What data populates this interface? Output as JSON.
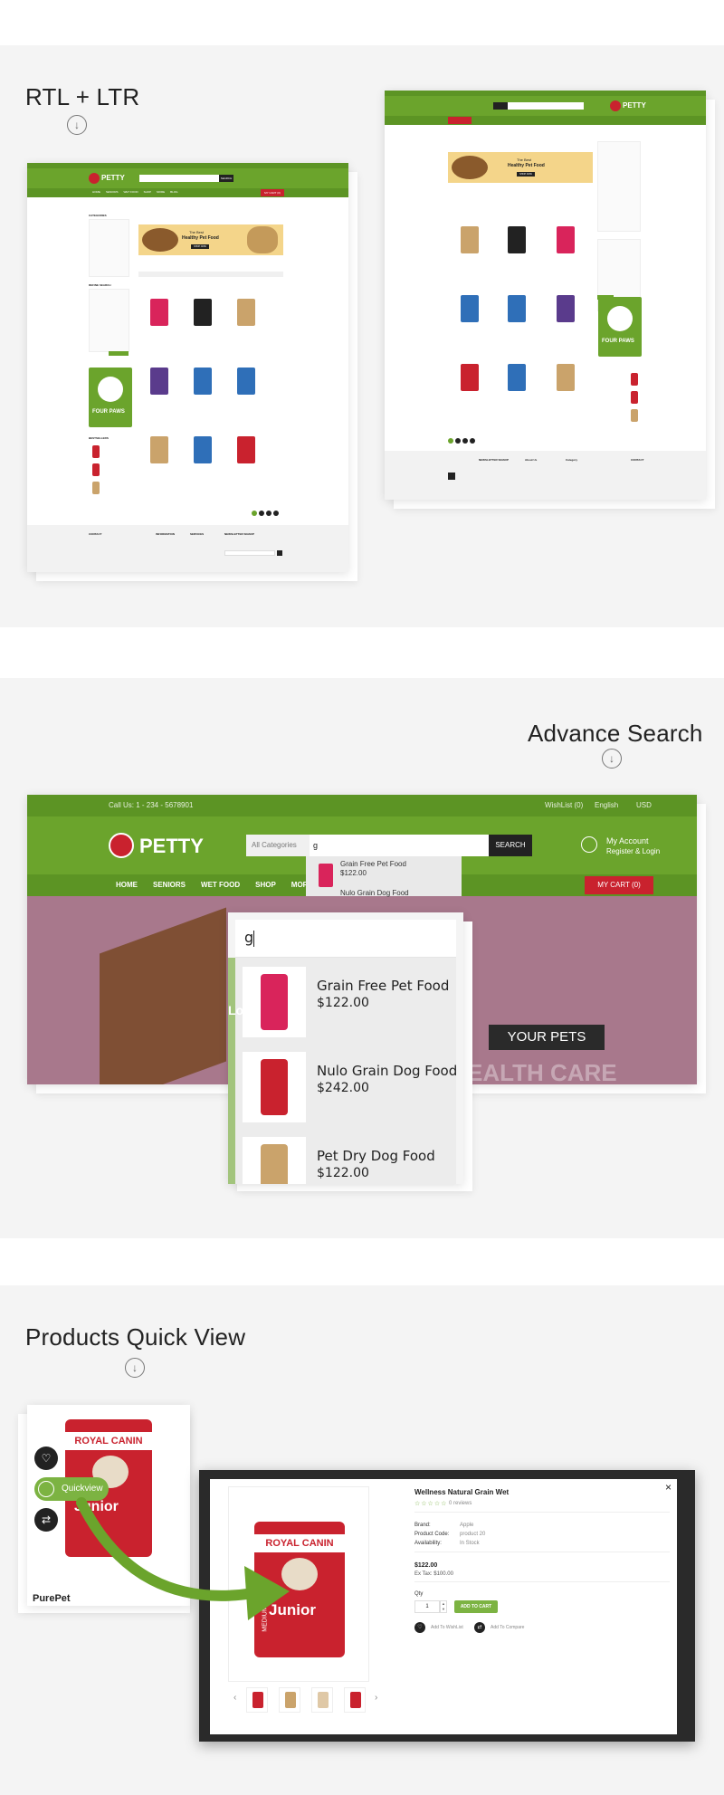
{
  "sections": {
    "rtl": {
      "title": "RTL + LTR"
    },
    "search": {
      "title": "Advance Search"
    },
    "quickview": {
      "title": "Products Quick View"
    }
  },
  "demo_ltr": {
    "brand": "PETTY",
    "search_placeholder": "Search",
    "search_button": "SEARCH",
    "cart": "MY CART (0)",
    "nav": [
      "HOME",
      "SENIORS",
      "WET FOOD",
      "SHOP",
      "MORE",
      "BLOG"
    ],
    "sidebar_titles": [
      "CATEGORIES",
      "REFINE SEARCH",
      "BESTSELLERS"
    ],
    "banner_line1": "The Best",
    "banner_line2": "Healthy Pet Food",
    "banner_button": "SHOP NOW",
    "footer_cols": [
      "CONTACT",
      "INFORMATION",
      "SERVICES",
      "NEWSLETTER SIGNUP"
    ],
    "sidebar_banner": "FOUR PAWS"
  },
  "demo_rtl": {
    "brand": "PETTY",
    "banner_line1": "The Best",
    "banner_line2": "Healthy Pet Food",
    "banner_button": "SHOP NOW",
    "sidebar_banner": "FOUR PAWS",
    "footer_cols": [
      "NEWSLETTER SIGNUP",
      "About Us",
      "Category",
      "CONTACT"
    ]
  },
  "search_demo": {
    "topbar_phone": "Call Us: 1 - 234 - 5678901",
    "topbar_wishlist": "WishList (0)",
    "topbar_language": "English",
    "topbar_currency": "USD",
    "brand": "PETTY",
    "category_select": "All Categories",
    "search_value": "g",
    "search_button": "SEARCH",
    "account_title": "My Account",
    "account_sub": "Register & Login",
    "nav": [
      "HOME",
      "SENIORS",
      "WET FOOD",
      "SHOP",
      "MORE",
      "BL"
    ],
    "cart": "MY CART (0)",
    "hero_button": "YOUR PETS",
    "hero_text": "EALTH CARE",
    "back_results": [
      {
        "name": "Grain Free Pet Food",
        "price": "$122.00"
      },
      {
        "name": "Nulo Grain Dog Food",
        "price": ""
      }
    ],
    "zoom_query": "g",
    "results": [
      {
        "name": "Grain Free Pet Food",
        "price": "$122.00"
      },
      {
        "name": "Nulo Grain Dog Food",
        "price": "$242.00"
      },
      {
        "name": "Pet Dry Dog Food",
        "price": "$122.00"
      }
    ],
    "side_letters": [
      "Lo"
    ]
  },
  "quickview_demo": {
    "card_title": "PurePet",
    "quickview_button": "Quickview",
    "bag_brand": "ROYAL CANIN",
    "bag_variant": "Junior",
    "bag_size": "MEDIUM",
    "product_name": "Wellness Natural Grain Wet",
    "reviews": "0 reviews",
    "fields": [
      {
        "label": "Brand:",
        "value": "Apple"
      },
      {
        "label": "Product Code:",
        "value": "product 20"
      },
      {
        "label": "Availability:",
        "value": "In Stock"
      }
    ],
    "price": "$122.00",
    "ex_tax": "Ex Tax: $100.00",
    "qty_label": "Qty",
    "qty_value": "1",
    "add_to_cart": "ADD TO CART",
    "add_wishlist": "Add To WishList",
    "add_compare": "Add To Compare",
    "close": "×",
    "prev": "‹",
    "next": "›"
  },
  "colors": {
    "green": "#6ba42c",
    "dark_green": "#5c9424",
    "red": "#c9222e",
    "hero_pink": "#a8788c"
  }
}
